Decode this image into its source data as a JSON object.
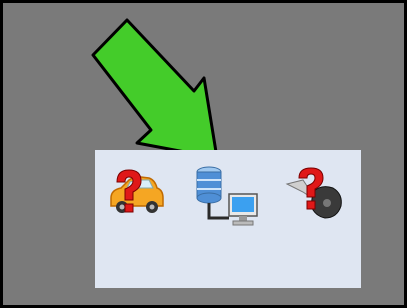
{
  "screen": {
    "description_icons": [
      {
        "name": "vehicle-unknown-icon"
      },
      {
        "name": "network-server-connection-icon"
      },
      {
        "name": "key-unknown-icon"
      }
    ],
    "colors": {
      "background": "#7a7a7a",
      "panel": "#dfe6f2",
      "arrow_fill": "#44cc2a",
      "arrow_stroke": "#000000",
      "question_mark": "#e01818"
    }
  }
}
